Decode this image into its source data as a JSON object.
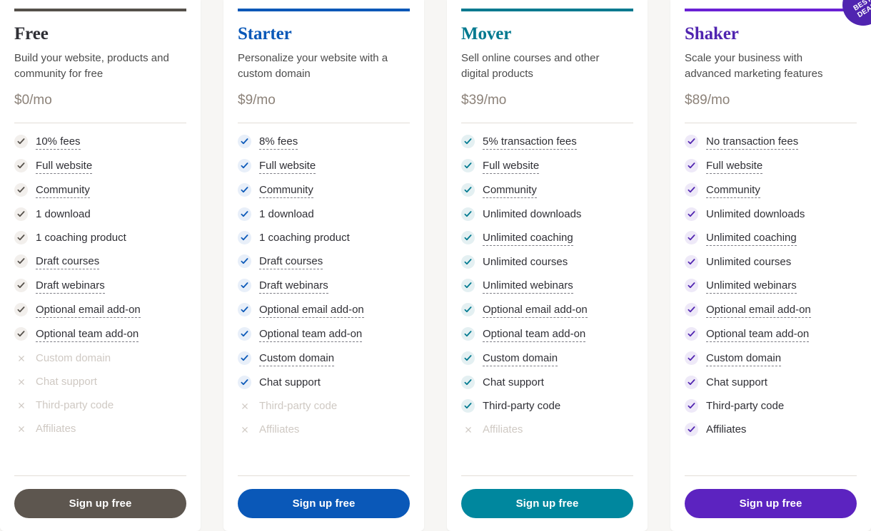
{
  "page": {
    "background": "#f7f6f4",
    "cta_label": "Sign up free",
    "badge": {
      "line1": "BEST",
      "line2": "DEAL",
      "color": "#5024b0"
    }
  },
  "plans": [
    {
      "name": "Free",
      "description": "Build your website, products and community for free",
      "price": "$0/mo",
      "accent": "#55504a",
      "name_color": "#2f2f35",
      "check_color": "#55504a",
      "check_bg": "#f2efec",
      "button_color": "#5d564f",
      "cta_label": "Sign up free",
      "badge": false,
      "features": [
        {
          "label": "10% fees",
          "included": true,
          "tip": true
        },
        {
          "label": "Full website",
          "included": true,
          "tip": true
        },
        {
          "label": "Community",
          "included": true,
          "tip": true
        },
        {
          "label": "1 download",
          "included": true,
          "tip": false
        },
        {
          "label": "1 coaching product",
          "included": true,
          "tip": false
        },
        {
          "label": "Draft courses",
          "included": true,
          "tip": true
        },
        {
          "label": "Draft webinars",
          "included": true,
          "tip": true
        },
        {
          "label": "Optional email add-on",
          "included": true,
          "tip": true
        },
        {
          "label": "Optional team add-on",
          "included": true,
          "tip": true
        },
        {
          "label": "Custom domain",
          "included": false,
          "tip": false
        },
        {
          "label": "Chat support",
          "included": false,
          "tip": false
        },
        {
          "label": "Third-party code",
          "included": false,
          "tip": false
        },
        {
          "label": "Affiliates",
          "included": false,
          "tip": false
        }
      ]
    },
    {
      "name": "Starter",
      "description": "Personalize your website with a custom domain",
      "price": "$9/mo",
      "accent": "#0a58b8",
      "name_color": "#0a58b8",
      "check_color": "#0a58b8",
      "check_bg": "#e8eff9",
      "button_color": "#0a58b8",
      "cta_label": "Sign up free",
      "badge": false,
      "features": [
        {
          "label": "8% fees",
          "included": true,
          "tip": true
        },
        {
          "label": "Full website",
          "included": true,
          "tip": true
        },
        {
          "label": "Community",
          "included": true,
          "tip": true
        },
        {
          "label": "1 download",
          "included": true,
          "tip": false
        },
        {
          "label": "1 coaching product",
          "included": true,
          "tip": false
        },
        {
          "label": "Draft courses",
          "included": true,
          "tip": true
        },
        {
          "label": "Draft webinars",
          "included": true,
          "tip": true
        },
        {
          "label": "Optional email add-on",
          "included": true,
          "tip": true
        },
        {
          "label": "Optional team add-on",
          "included": true,
          "tip": true
        },
        {
          "label": "Custom domain",
          "included": true,
          "tip": true
        },
        {
          "label": "Chat support",
          "included": true,
          "tip": false
        },
        {
          "label": "Third-party code",
          "included": false,
          "tip": false
        },
        {
          "label": "Affiliates",
          "included": false,
          "tip": false
        }
      ]
    },
    {
      "name": "Mover",
      "description": "Sell online courses and other digital products",
      "price": "$39/mo",
      "accent": "#00798f",
      "name_color": "#00798f",
      "check_color": "#00798f",
      "check_bg": "#e4f0f2",
      "button_color": "#00879e",
      "cta_label": "Sign up free",
      "badge": false,
      "features": [
        {
          "label": "5% transaction fees",
          "included": true,
          "tip": true
        },
        {
          "label": "Full website",
          "included": true,
          "tip": true
        },
        {
          "label": "Community",
          "included": true,
          "tip": true
        },
        {
          "label": "Unlimited downloads",
          "included": true,
          "tip": false
        },
        {
          "label": "Unlimited coaching",
          "included": true,
          "tip": true
        },
        {
          "label": "Unlimited courses",
          "included": true,
          "tip": false
        },
        {
          "label": "Unlimited webinars",
          "included": true,
          "tip": true
        },
        {
          "label": "Optional email add-on",
          "included": true,
          "tip": true
        },
        {
          "label": "Optional team add-on",
          "included": true,
          "tip": true
        },
        {
          "label": "Custom domain",
          "included": true,
          "tip": true
        },
        {
          "label": "Chat support",
          "included": true,
          "tip": false
        },
        {
          "label": "Third-party code",
          "included": true,
          "tip": false
        },
        {
          "label": "Affiliates",
          "included": false,
          "tip": false
        }
      ]
    },
    {
      "name": "Shaker",
      "description": "Scale your business with advanced marketing features",
      "price": "$89/mo",
      "accent": "#6a21d4",
      "name_color": "#5024b0",
      "check_color": "#5024b0",
      "check_bg": "#eee9f8",
      "button_color": "#5c23c0",
      "cta_label": "Sign up free",
      "badge": true,
      "features": [
        {
          "label": "No transaction fees",
          "included": true,
          "tip": true
        },
        {
          "label": "Full website",
          "included": true,
          "tip": true
        },
        {
          "label": "Community",
          "included": true,
          "tip": true
        },
        {
          "label": "Unlimited downloads",
          "included": true,
          "tip": false
        },
        {
          "label": "Unlimited coaching",
          "included": true,
          "tip": true
        },
        {
          "label": "Unlimited courses",
          "included": true,
          "tip": false
        },
        {
          "label": "Unlimited webinars",
          "included": true,
          "tip": true
        },
        {
          "label": "Optional email add-on",
          "included": true,
          "tip": true
        },
        {
          "label": "Optional team add-on",
          "included": true,
          "tip": true
        },
        {
          "label": "Custom domain",
          "included": true,
          "tip": true
        },
        {
          "label": "Chat support",
          "included": true,
          "tip": false
        },
        {
          "label": "Third-party code",
          "included": true,
          "tip": false
        },
        {
          "label": "Affiliates",
          "included": true,
          "tip": false
        }
      ]
    }
  ]
}
